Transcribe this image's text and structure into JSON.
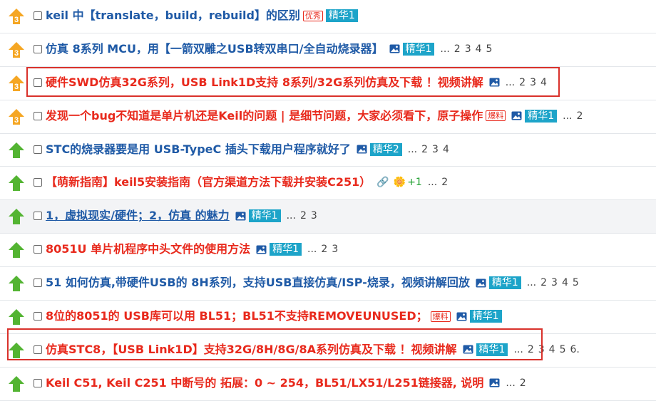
{
  "rows": [
    {
      "status": "hot",
      "title": "keil 中【translate，build，rebuild】的区别",
      "color": "blue",
      "badge": "优秀",
      "tag": "精华1",
      "pages": []
    },
    {
      "status": "hot",
      "title": "仿真 8系列 MCU，用【一箭双雕之USB转双串口/全自动烧录器】",
      "color": "blue",
      "image": true,
      "tag": "精华1",
      "pages": [
        "2",
        "3",
        "4",
        "5"
      ]
    },
    {
      "status": "hot",
      "title": "硬件SWD仿真32G系列，USB Link1D支持 8系列/32G系列仿真及下载 ！视频讲解",
      "color": "red",
      "image": true,
      "pages": [
        "2",
        "3",
        "4"
      ]
    },
    {
      "status": "hot",
      "title": "发现一个bug不知道是单片机还是Keil的问题 | 是细节问题，大家必须看下，原子操作",
      "color": "red",
      "badge": "爆料",
      "image": true,
      "tag": "精华1",
      "pages": [
        "2"
      ]
    },
    {
      "status": "up",
      "title": "STC的烧录器要是用 USB-TypeC 插头下载用户程序就好了",
      "color": "blue",
      "image": true,
      "tag": "精华2",
      "pages": [
        "2",
        "3",
        "4"
      ]
    },
    {
      "status": "up",
      "title": "【萌新指南】keil5安装指南（官方渠道方法下载并安装C251）",
      "color": "red",
      "clip": true,
      "plus": "+1",
      "pages": [
        "2"
      ]
    },
    {
      "status": "up",
      "title": "1，虚拟现实/硬件；2，仿真 的魅力",
      "color": "blue",
      "underline": true,
      "image": true,
      "tag": "精华1",
      "pages": [
        "2",
        "3"
      ]
    },
    {
      "status": "up",
      "title": "8051U 单片机程序中头文件的使用方法",
      "color": "red",
      "image": true,
      "tag": "精华1",
      "pages": [
        "2",
        "3"
      ]
    },
    {
      "status": "up",
      "title": "51 如何仿真,带硬件USB的 8H系列，支持USB直接仿真/ISP-烧录，视频讲解回放",
      "color": "blue",
      "image": true,
      "tag": "精华1",
      "pages": [
        "2",
        "3",
        "4",
        "5"
      ]
    },
    {
      "status": "up",
      "title": "8位的8051的 USB库可以用 BL51；BL51不支持REMOVEUNUSED；",
      "color": "red",
      "badge": "爆料",
      "image": true,
      "tag": "精华1",
      "pages": []
    },
    {
      "status": "up",
      "title": "仿真STC8，【USB Link1D】支持32G/8H/8G/8A系列仿真及下载 ！视频讲解",
      "color": "red",
      "image": true,
      "tag": "精华1",
      "pages": [
        "2",
        "3",
        "4",
        "5",
        "6"
      ],
      "more": "."
    },
    {
      "status": "up",
      "title": "Keil C51, Keil C251 中断号的 拓展：0 ~ 254，BL51/LX51/L251链接器, 说明",
      "color": "red",
      "image": true,
      "pages": [
        "2"
      ]
    }
  ],
  "ellipsis": "..."
}
